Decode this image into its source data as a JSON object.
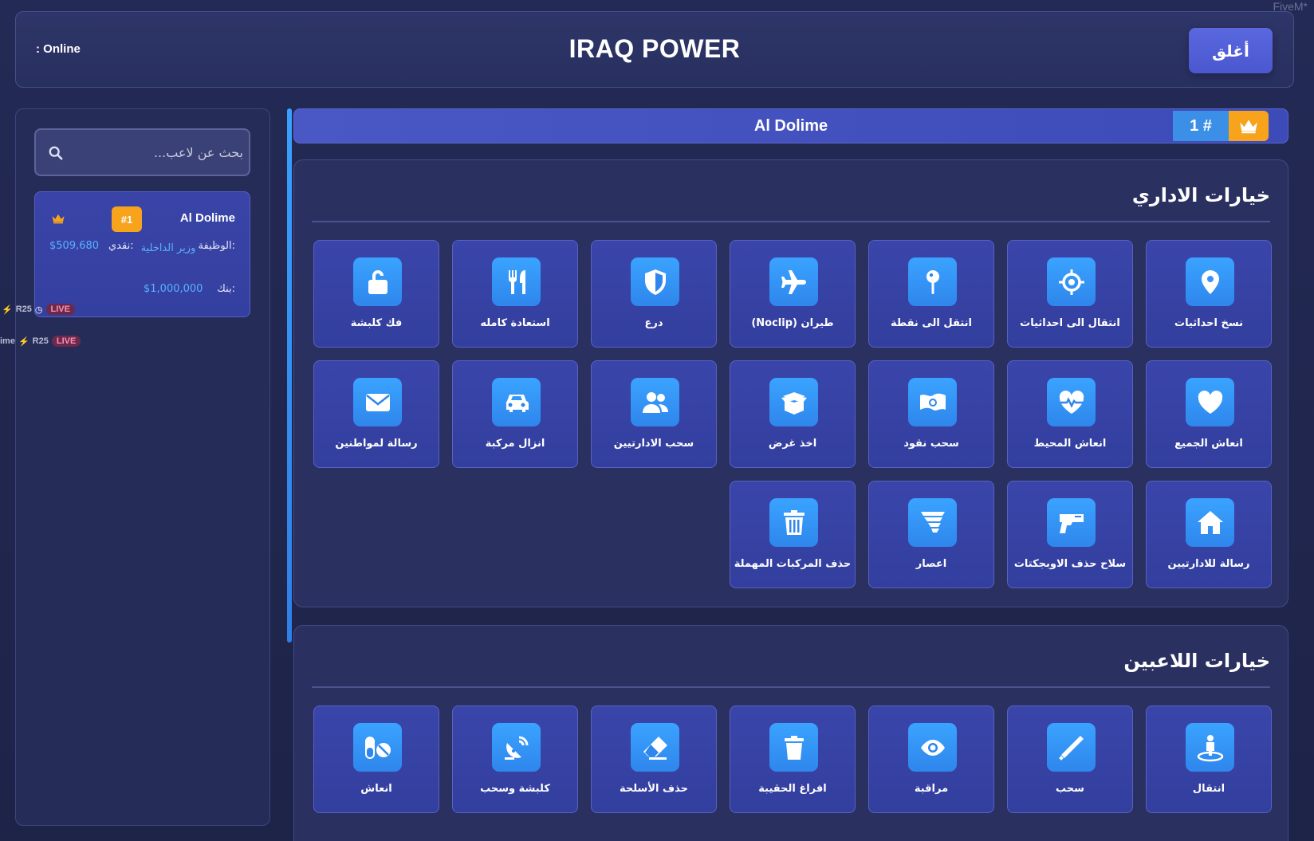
{
  "window": {
    "brand": "FiveM*"
  },
  "header": {
    "online_label": ": Online",
    "title": "IRAQ POWER",
    "close_label": "أغلق"
  },
  "search": {
    "placeholder": "بحث عن لاعب..."
  },
  "player_card": {
    "name": "Al Dolime",
    "rank": "#1",
    "job_label": "الوظيفة:",
    "job_value": "وزير الداخلية",
    "cash_label": "نقدي:",
    "cash_value": "$509,680",
    "bank_label": "بنك:",
    "bank_value": "$1,000,000"
  },
  "overlay_tags": [
    {
      "prefix": "",
      "r": "R25",
      "live": "LIVE"
    },
    {
      "prefix": "ime",
      "r": "R25",
      "live": "LIVE"
    }
  ],
  "selected_bar": {
    "name": "Al Dolime",
    "rank": "1 #"
  },
  "admin_section": {
    "title": "خيارات الاداري",
    "tiles": [
      {
        "label": "نسخ احداثيات",
        "icon": "map-pin-icon"
      },
      {
        "label": "انتقال الى احداثيات",
        "icon": "crosshair-icon"
      },
      {
        "label": "انتقل الى نقطة",
        "icon": "map-marker-icon"
      },
      {
        "label": "طيران (Noclip)",
        "icon": "plane-icon"
      },
      {
        "label": "درع",
        "icon": "shield-icon"
      },
      {
        "label": "استعادة كامله",
        "icon": "utensils-icon"
      },
      {
        "label": "فك كلبشة",
        "icon": "unlock-icon"
      },
      {
        "label": "انعاش الجميع",
        "icon": "heart-icon"
      },
      {
        "label": "انعاش المحيط",
        "icon": "heart-pulse-icon"
      },
      {
        "label": "سحب نقود",
        "icon": "money-icon"
      },
      {
        "label": "اخذ غرض",
        "icon": "box-open-icon"
      },
      {
        "label": "سحب الادارتيين",
        "icon": "users-icon"
      },
      {
        "label": "انزال مركبة",
        "icon": "car-icon"
      },
      {
        "label": "رسالة لمواطنين",
        "icon": "envelope-icon"
      },
      {
        "label": "رسالة للادارتيين",
        "icon": "home-icon"
      },
      {
        "label": "سلاح حذف الاوبجكتات",
        "icon": "gun-icon"
      },
      {
        "label": "اعصار",
        "icon": "tornado-icon"
      },
      {
        "label": "حذف المركبات المهملة",
        "icon": "trash-icon"
      }
    ]
  },
  "players_section": {
    "title": "خيارات اللاعبين",
    "tiles": [
      {
        "label": "انتقال",
        "icon": "person-teleport-icon"
      },
      {
        "label": "سحب",
        "icon": "wand-icon"
      },
      {
        "label": "مراقبة",
        "icon": "eye-icon"
      },
      {
        "label": "افراغ الحقيبة",
        "icon": "trash-can-icon"
      },
      {
        "label": "حذف الأسلحة",
        "icon": "eraser-icon"
      },
      {
        "label": "كلبشة وسحب",
        "icon": "satellite-dish-icon"
      },
      {
        "label": "انعاش",
        "icon": "pills-icon"
      }
    ]
  }
}
